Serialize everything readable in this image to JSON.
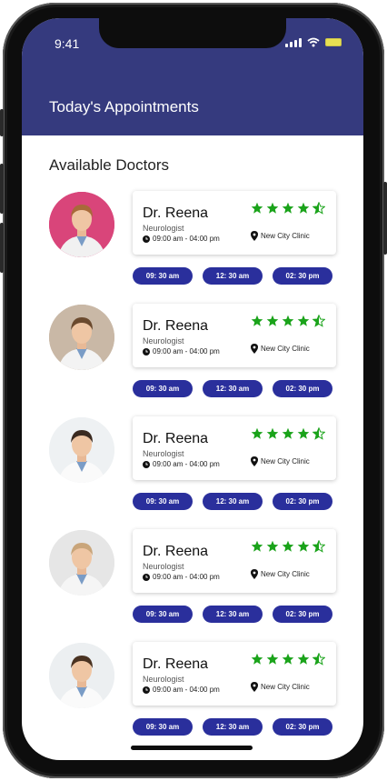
{
  "status_bar": {
    "time": "9:41"
  },
  "header": {
    "title": "Today's Appointments"
  },
  "section": {
    "title": "Available Doctors"
  },
  "doctors": [
    {
      "name": "Dr. Reena",
      "specialty": "Neurologist",
      "hours": "09:00 am - 04:00 pm",
      "location": "New City Clinic",
      "rating": 4.5,
      "slots": [
        "09: 30 am",
        "12: 30 am",
        "02: 30 pm"
      ],
      "avatar_bg": "#d9457a",
      "coat": "#f1f1f1",
      "hair": "#a86a3a"
    },
    {
      "name": "Dr. Reena",
      "specialty": "Neurologist",
      "hours": "09:00 am - 04:00 pm",
      "location": "New City Clinic",
      "rating": 4.5,
      "slots": [
        "09: 30 am",
        "12: 30 am",
        "02: 30 pm"
      ],
      "avatar_bg": "#c9b8a6",
      "coat": "#f3f3f3",
      "hair": "#6b4a2e"
    },
    {
      "name": "Dr. Reena",
      "specialty": "Neurologist",
      "hours": "09:00 am - 04:00 pm",
      "location": "New City Clinic",
      "rating": 4.5,
      "slots": [
        "09: 30 am",
        "12: 30 am",
        "02: 30 pm"
      ],
      "avatar_bg": "#eef1f3",
      "coat": "#fafafa",
      "hair": "#3a2a20"
    },
    {
      "name": "Dr. Reena",
      "specialty": "Neurologist",
      "hours": "09:00 am - 04:00 pm",
      "location": "New City Clinic",
      "rating": 4.5,
      "slots": [
        "09: 30 am",
        "12: 30 am",
        "02: 30 pm"
      ],
      "avatar_bg": "#e6e6e6",
      "coat": "#f5f5f5",
      "hair": "#c9a57a"
    },
    {
      "name": "Dr. Reena",
      "specialty": "Neurologist",
      "hours": "09:00 am - 04:00 pm",
      "location": "New City Clinic",
      "rating": 4.5,
      "slots": [
        "09: 30 am",
        "12: 30 am",
        "02: 30 pm"
      ],
      "avatar_bg": "#eceff1",
      "coat": "#fafafa",
      "hair": "#4a3322"
    }
  ],
  "colors": {
    "header": "#353a7e",
    "slot": "#2a2f9c",
    "star": "#1aa31a"
  },
  "icons": {
    "clock": "clock-icon",
    "location": "location-pin-icon",
    "star": "star-icon",
    "signal": "signal-icon",
    "wifi": "wifi-icon",
    "battery": "battery-icon"
  }
}
